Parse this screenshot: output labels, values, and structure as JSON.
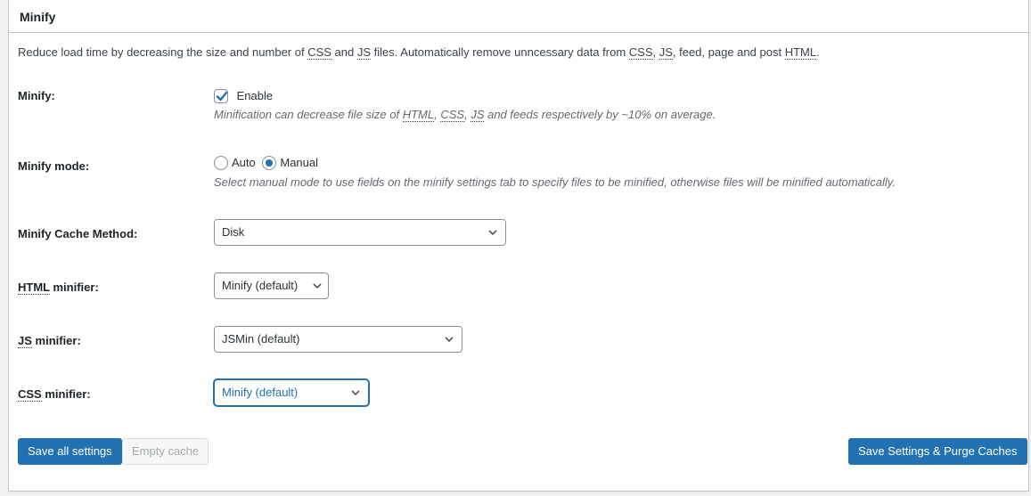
{
  "panel": {
    "title": "Minify"
  },
  "intro": {
    "p1": "Reduce load time by decreasing the size and number of ",
    "a1": "CSS",
    "p2": " and ",
    "a2": "JS",
    "p3": " files. Automatically remove unncessary data from ",
    "a3": "CSS",
    "p4": ", ",
    "a4": "JS",
    "p5": ", feed, page and post ",
    "a5": "HTML",
    "p6": "."
  },
  "minify": {
    "label": "Minify:",
    "checkbox_label": "Enable",
    "checked": true,
    "desc": {
      "p1": "Minification can decrease file size of ",
      "a1": "HTML",
      "p2": ", ",
      "a2": "CSS",
      "p3": ", ",
      "a3": "JS",
      "p4": " and feeds respectively by ~10% on average."
    }
  },
  "mode": {
    "label": "Minify mode:",
    "options": [
      "Auto",
      "Manual"
    ],
    "selected": "Manual",
    "desc": "Select manual mode to use fields on the minify settings tab to specify files to be minified, otherwise files will be minified automatically."
  },
  "cache_method": {
    "label": "Minify Cache Method:",
    "value": "Disk"
  },
  "html_minifier": {
    "label_abbr": "HTML",
    "label_rest": " minifier:",
    "value": "Minify (default)"
  },
  "js_minifier": {
    "label_abbr": "JS",
    "label_rest": " minifier:",
    "value": "JSMin (default)"
  },
  "css_minifier": {
    "label_abbr": "CSS",
    "label_rest": " minifier:",
    "value": "Minify (default)"
  },
  "buttons": {
    "save_all": "Save all settings",
    "empty_cache": "Empty cache",
    "save_purge": "Save Settings & Purge Caches"
  },
  "colors": {
    "accent": "#2271b1"
  }
}
